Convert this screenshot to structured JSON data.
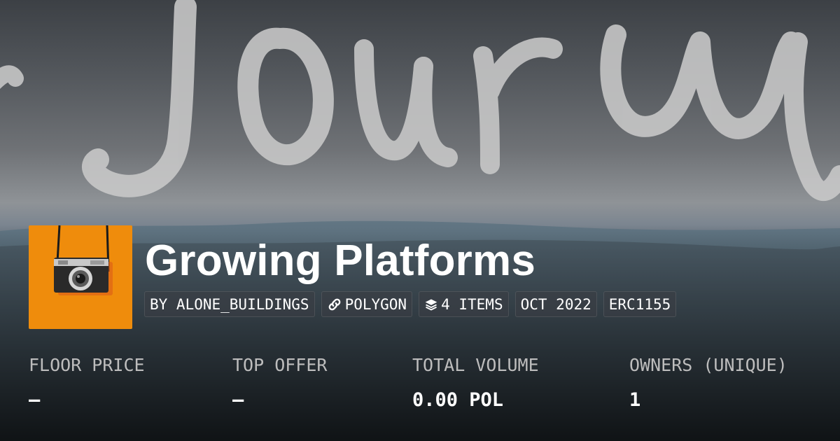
{
  "banner": {
    "watermark_text": "Journ"
  },
  "collection": {
    "name": "Growing Platforms",
    "logo_icon": "camera-icon",
    "logo_bg": "#ef8c0c"
  },
  "chips": {
    "creator": "BY ALONE_BUILDINGS",
    "chain": "POLYGON",
    "chain_icon": "link-icon",
    "items": "4 ITEMS",
    "items_icon": "layers-icon",
    "date": "OCT 2022",
    "standard": "ERC1155"
  },
  "stats": {
    "floor_price": {
      "label": "FLOOR PRICE",
      "value": "–"
    },
    "top_offer": {
      "label": "TOP OFFER",
      "value": "–"
    },
    "total_volume": {
      "label": "TOTAL VOLUME",
      "value": "0.00 POL"
    },
    "owners": {
      "label": "OWNERS (UNIQUE)",
      "value": "1"
    }
  }
}
